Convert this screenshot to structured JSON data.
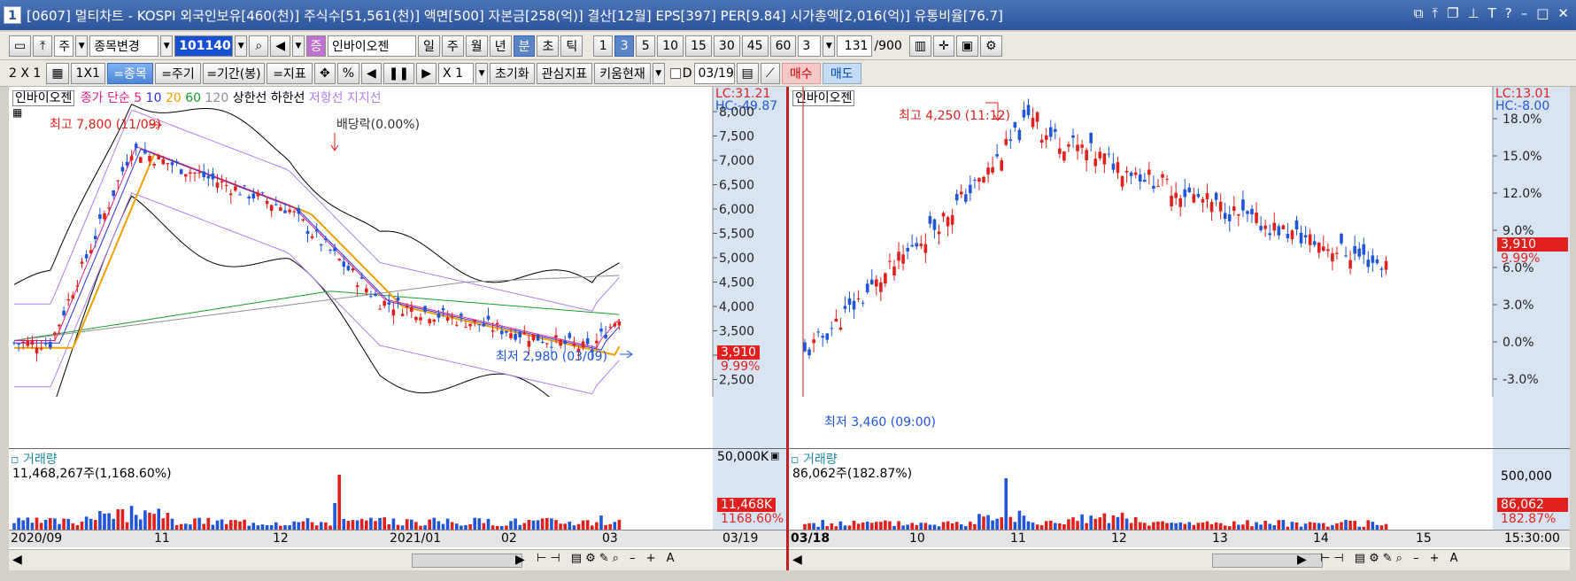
{
  "window": {
    "number": "1",
    "title": "[0607] 멀티차트 - KOSPI 외국인보유[460(천)] 주식수[51,561(천)] 액면[500] 자본금[258(억)] 결산[12월] EPS[397] PER[9.84] 시가총액[2,016(억)] 유통비율[76.7]"
  },
  "toolbar1": {
    "type_select": "주",
    "stock_change": "종목변경",
    "code": "101140",
    "stock_name": "인바이오젠",
    "stock_badge": "증",
    "periods": [
      "일",
      "주",
      "월",
      "년",
      "분",
      "초",
      "틱"
    ],
    "selected_period": "분",
    "intervals": [
      "1",
      "3",
      "5",
      "10",
      "15",
      "30",
      "45",
      "60"
    ],
    "selected_interval": "3",
    "interval_input": "3",
    "count": "131",
    "count_max": "/900"
  },
  "toolbar2": {
    "layout": "2 X 1",
    "layout_1x1": "1X1",
    "buttons": [
      "=종목",
      "=주기",
      "=기간(봉)",
      "=지표"
    ],
    "percent": "%",
    "multiplier": "X 1",
    "reset": "초기화",
    "watch": "관심지표",
    "kiwoom": "키움현재",
    "date_label": "D",
    "date": "03/19",
    "buy": "매수",
    "sell": "매도"
  },
  "left": {
    "stock": "인바이오젠",
    "indicator_legend": {
      "label": "종가 단순",
      "mas": [
        "5",
        "10",
        "20",
        "60",
        "120"
      ],
      "upper": "상한선",
      "lower": "하한선",
      "resist": "저항선",
      "support": "지지선"
    },
    "lc": "LC:31.21",
    "hc": "HC:-49.87",
    "price_ticks": [
      "8,000",
      "7,500",
      "7,000",
      "6,500",
      "6,000",
      "5,500",
      "5,000",
      "4,500",
      "4,000",
      "3,500",
      "3,000",
      "2,500"
    ],
    "current_price": "3,910",
    "current_pct": "9.99%",
    "high_label": "최고 7,800 (11/09)",
    "low_label": "최저 2,980 (03/09)",
    "dividend_label": "배당락(0.00%)",
    "volume": {
      "title": "거래량",
      "value": "11,468,267주(1,168.60%)",
      "axis_top": "50,000K",
      "current": "11,468K",
      "current_pct": "1168.60%"
    },
    "x_labels": [
      "2020/09",
      "11",
      "12",
      "2021/01",
      "02",
      "03"
    ],
    "x_right": "03/19"
  },
  "right": {
    "stock": "인바이오젠",
    "lc": "LC:13.01",
    "hc": "HC:-8.00",
    "pct_ticks": [
      "18.0%",
      "15.0%",
      "12.0%",
      "9.0%",
      "6.0%",
      "3.0%",
      "0.0%",
      "-3.0%"
    ],
    "current_price": "3,910",
    "current_pct": "9.99%",
    "high_label": "최고 4,250 (11:12)",
    "low_label": "최저 3,460 (09:00)",
    "volume": {
      "title": "거래량",
      "value": "86,062주(182.87%)",
      "axis_top": "500,000",
      "current": "86,062",
      "current_pct": "182.87%"
    },
    "x_labels": [
      "03/18",
      "10",
      "11",
      "12",
      "13",
      "14",
      "15"
    ],
    "x_right": "15:30:00"
  },
  "colors": {
    "up": "#e0201c",
    "down": "#1f56d8",
    "ma5": "#e0208a",
    "ma10": "#3030e0",
    "ma20": "#f0a000",
    "ma60": "#16a030",
    "ma120": "#909090",
    "band": "#000000",
    "env": "#b080f0",
    "accent_titlebar": "#2e559c"
  }
}
